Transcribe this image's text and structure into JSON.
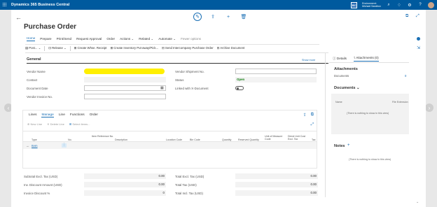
{
  "app": {
    "title": "Dynamics 365 Business Central"
  },
  "environment": {
    "logo": "BC",
    "line1": "Environment:",
    "line2": "Michael Sandbox"
  },
  "page": {
    "title": "Purchase Order"
  },
  "menu": {
    "items": [
      "Home",
      "Prepare",
      "Print/Send",
      "Request Approval",
      "Order",
      "Actions",
      "Related",
      "Automate",
      "Fewer options"
    ]
  },
  "actions": {
    "post": "Post...",
    "release": "Release",
    "create_whse_receipt": "Create Whse. Receipt",
    "create_inventory": "Create Inventory Put-away/Pick...",
    "send_intercompany": "Send Intercompany Purchase Order",
    "archive": "Archive Document"
  },
  "general": {
    "title": "General",
    "show_more": "Show more",
    "vendor_name_label": "Vendor Name",
    "contact_label": "Contact",
    "document_date_label": "Document Date",
    "vendor_invoice_label": "Vendor Invoice No.",
    "vendor_shipment_label": "Vendor Shipment No.",
    "status_label": "Status",
    "status_value": "Open",
    "linked_label": "Linked with X-Document"
  },
  "lines": {
    "tabs": [
      "Lines",
      "Manage",
      "Line",
      "Functions",
      "Order"
    ],
    "new_line": "New Line",
    "delete_line": "Delete Line",
    "select_items": "Select items...",
    "columns": {
      "type": "Type",
      "no": "No.",
      "item_ref": "Item Reference No.",
      "description": "Description",
      "location": "Location Code",
      "bin": "Bin Code",
      "quantity": "Quantity",
      "received": "Reserved Quantity",
      "uom": "Unit of Measure Code",
      "direct_unit_cost": "Direct Unit Cost Excl. Tax",
      "tax": "Tax"
    },
    "row_type": "Item"
  },
  "totals": {
    "subtotal_label": "Subtotal Excl. Tax (USD)",
    "subtotal_value": "0.00",
    "inv_discount_label": "Inv. Discount Amount (USD)",
    "inv_discount_value": "0.00",
    "invoice_discount_pct_label": "Invoice Discount %",
    "invoice_discount_pct_value": "0",
    "total_excl_label": "Total Excl. Tax (USD)",
    "total_excl_value": "0.00",
    "total_tax_label": "Total Tax (USD)",
    "total_tax_value": "0.00",
    "total_incl_label": "Total Incl. Tax (USD)",
    "total_incl_value": "0.00"
  },
  "factbox": {
    "tab_details": "Details",
    "tab_attachments": "Attachments (0)",
    "attachments_title": "Attachments",
    "documents_label": "Documents",
    "documents_count": "0",
    "documents_title": "Documents",
    "name_col": "Name",
    "file_ext_col": "File Extension",
    "empty_text": "(There is nothing to show in this view)",
    "notes_title": "Notes",
    "notes_empty": "(There is nothing to show in this view)"
  }
}
